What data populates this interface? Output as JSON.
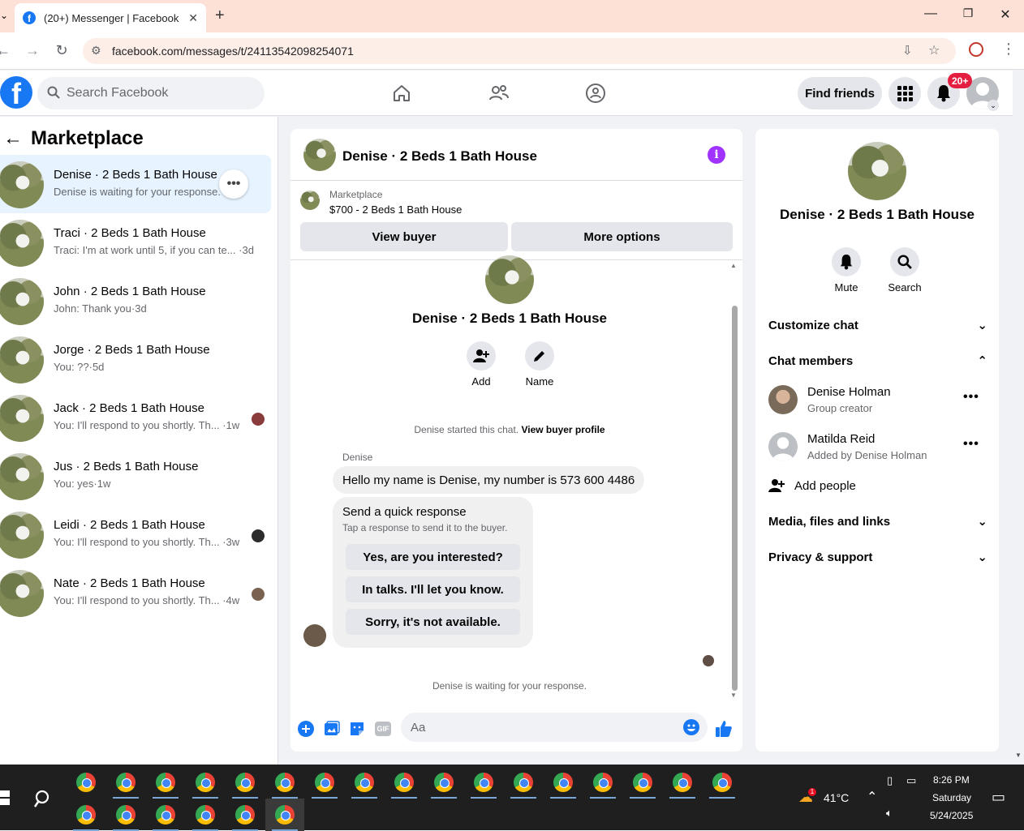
{
  "browser": {
    "tab_title": "(20+) Messenger | Facebook",
    "url": "facebook.com/messages/t/24113542098254071"
  },
  "fb": {
    "search_placeholder": "Search Facebook",
    "find_friends": "Find friends",
    "notif_badge": "20+"
  },
  "left": {
    "title": "Marketplace",
    "conversations": [
      {
        "name": "Denise · 2 Beds 1 Bath House",
        "preview": "Denise is waiting for your response.",
        "active": true
      },
      {
        "name": "Traci · 2 Beds 1 Bath House",
        "preview": "Traci: I'm at work until 5, if you can te... ·3d"
      },
      {
        "name": "John · 2 Beds 1 Bath House",
        "preview": "John: Thank you·3d"
      },
      {
        "name": "Jorge · 2 Beds 1 Bath House",
        "preview": "You: ??·5d"
      },
      {
        "name": "Jack · 2 Beds 1 Bath House",
        "preview": "You: I'll respond to you shortly. Th...  ·1w"
      },
      {
        "name": "Jus · 2 Beds 1 Bath House",
        "preview": "You: yes·1w"
      },
      {
        "name": "Leidi · 2 Beds 1 Bath House",
        "preview": "You: I'll respond to you shortly. Th...  ·3w"
      },
      {
        "name": "Nate · 2 Beds 1 Bath House",
        "preview": "You: I'll respond to you shortly. Th...  ·4w"
      }
    ]
  },
  "chat": {
    "title": "Denise · 2 Beds 1 Bath House",
    "listing_source": "Marketplace",
    "listing_title": "$700 - 2 Beds 1 Bath House",
    "view_buyer": "View buyer",
    "more_options": "More options",
    "big_name": "Denise · 2 Beds 1 Bath House",
    "add_label": "Add",
    "name_label": "Name",
    "started_text": "Denise started this chat.",
    "view_buyer_profile": "View buyer profile",
    "sender": "Denise",
    "message": "Hello my name is Denise, my number is 573 600 4486",
    "quick_title": "Send a quick response",
    "quick_sub": "Tap a response to send it to the buyer.",
    "quick_replies": [
      "Yes, are you interested?",
      "In talks. I'll let you know.",
      "Sorry, it's not available."
    ],
    "waiting": "Denise is waiting for your response.",
    "input_placeholder": "Aa"
  },
  "right": {
    "name": "Denise · 2 Beds 1 Bath House",
    "mute": "Mute",
    "search": "Search",
    "customize_chat": "Customize chat",
    "chat_members": "Chat members",
    "members": [
      {
        "name": "Denise Holman",
        "role": "Group creator"
      },
      {
        "name": "Matilda Reid",
        "role": "Added by Denise Holman"
      }
    ],
    "add_people": "Add people",
    "media": "Media, files and links",
    "privacy": "Privacy & support"
  },
  "taskbar": {
    "temperature": "41°C",
    "time": "8:26 PM",
    "day": "Saturday",
    "date": "5/24/2025",
    "weather_badge": "1"
  },
  "colors": {
    "accent": "#1877f2",
    "active_row": "#e7f3ff",
    "info": "#a033ff",
    "badge": "#e41e3f"
  }
}
